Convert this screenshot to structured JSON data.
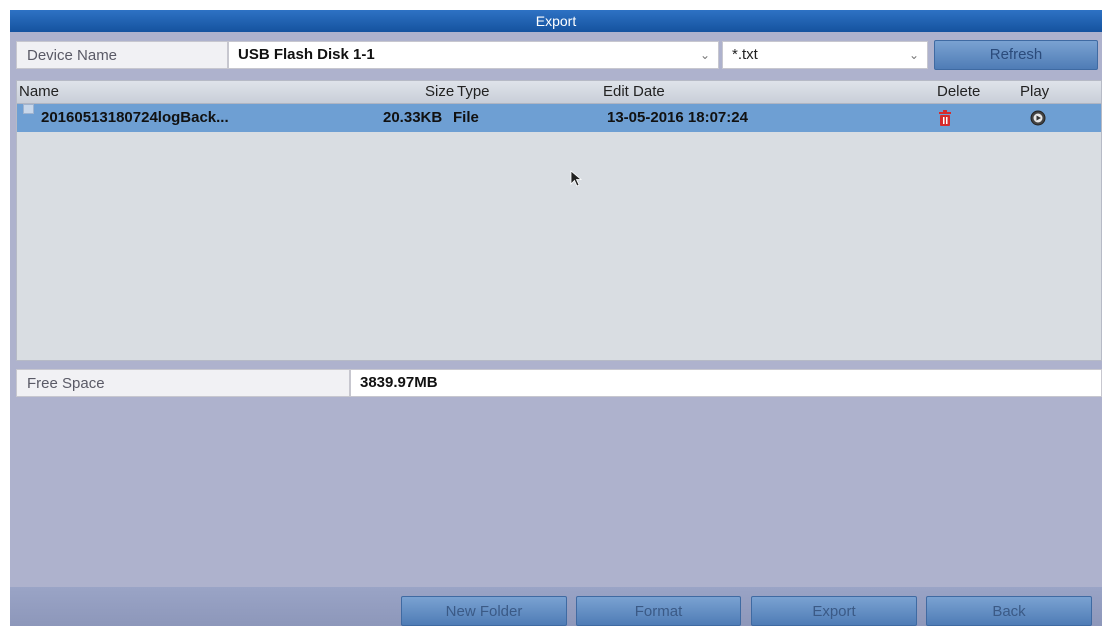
{
  "window": {
    "title": "Export"
  },
  "device": {
    "label": "Device Name",
    "value": "USB Flash Disk 1-1",
    "filter_value": "*.txt",
    "refresh_label": "Refresh"
  },
  "table": {
    "columns": {
      "name": "Name",
      "size": "Size",
      "type": "Type",
      "edit_date": "Edit Date",
      "delete": "Delete",
      "play": "Play"
    },
    "rows": [
      {
        "name": "20160513180724logBack...",
        "size": "20.33KB",
        "type": "File",
        "edit_date": "13-05-2016 18:07:24",
        "delete_icon": "trash-icon",
        "play_icon": "play-circle-icon"
      }
    ]
  },
  "free_space": {
    "label": "Free Space",
    "value": "3839.97MB"
  },
  "actions": {
    "new_folder": "New Folder",
    "format": "Format",
    "export": "Export",
    "back": "Back"
  },
  "colors": {
    "titlebar": "#1f62b4",
    "selected_row": "#6e9fd3",
    "button": "#5c87bf",
    "background": "#aeb2cd"
  }
}
